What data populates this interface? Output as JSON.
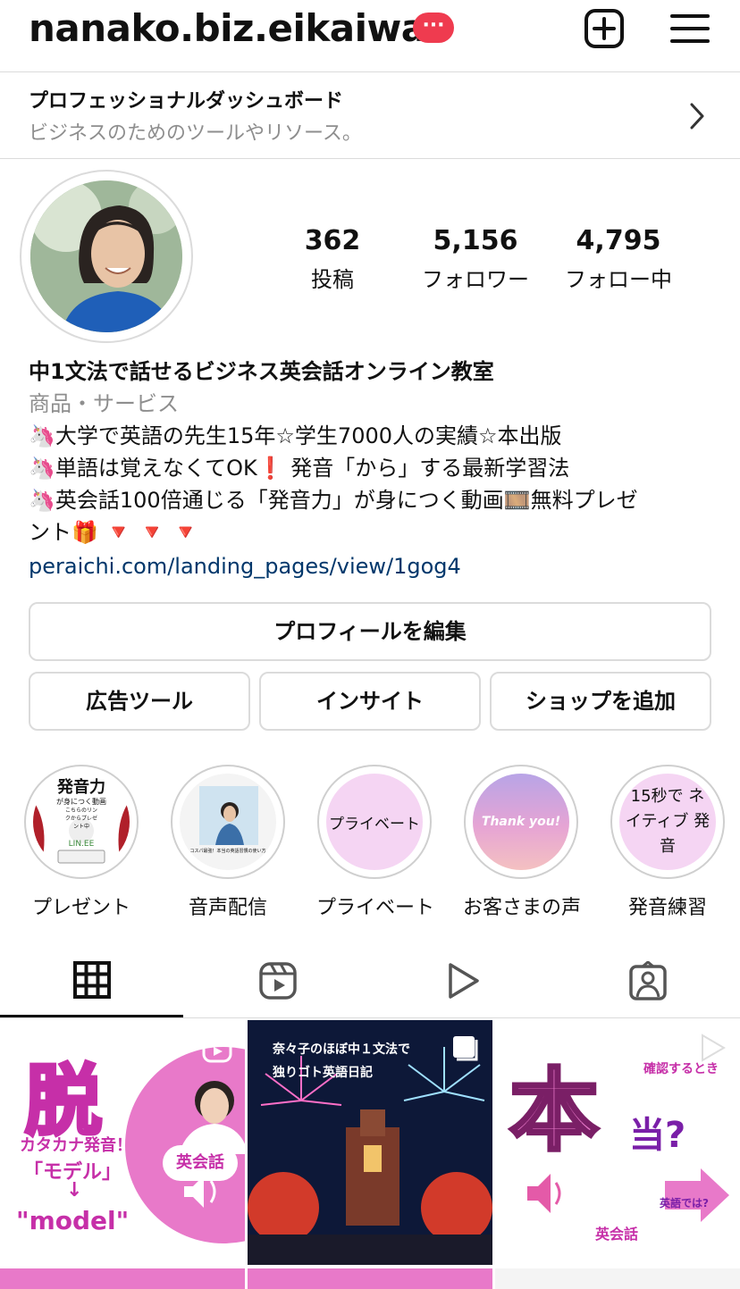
{
  "header": {
    "username": "nanako.biz.eikaiwa",
    "badge": "···"
  },
  "dashboard": {
    "title": "プロフェッショナルダッシュボード",
    "subtitle": "ビジネスのためのツールやリソース。"
  },
  "stats": [
    {
      "value": "362",
      "label": "投稿"
    },
    {
      "value": "5,156",
      "label": "フォロワー"
    },
    {
      "value": "4,795",
      "label": "フォロー中"
    }
  ],
  "bio": {
    "name": "中1文法で話せるビジネス英会話オンライン教室",
    "category": "商品・サービス",
    "lines": [
      "🦄大学で英語の先生15年☆学生7000人の実績☆本出版",
      "🦄単語は覚えなくてOK❗️ 発音「から」する最新学習法",
      "🦄英会話100倍通じる「発音力」が身につく動画🎞️無料プレゼ",
      "ント🎁 🔻 🔻 🔻"
    ],
    "link": "peraichi.com/landing_pages/view/1gog4"
  },
  "buttons": {
    "edit_profile": "プロフィールを編集",
    "ad_tools": "広告ツール",
    "insights": "インサイト",
    "add_shop": "ショップを追加"
  },
  "highlights": [
    {
      "label": "プレゼント",
      "cover_title": "発音力",
      "cover_sub": "が身につく動画",
      "cover_small": "こちらのリンクからプレゼント中",
      "cover_tag": "LIN.EE"
    },
    {
      "label": "音声配信",
      "cover_caption": "コスパ最強！本当の英語習慣の使い方"
    },
    {
      "label": "プライベート",
      "cover_text": "プライベート"
    },
    {
      "label": "お客さまの声",
      "cover_text": "Thank you!"
    },
    {
      "label": "発音練習",
      "cover_text": "15秒で ネイティブ 発音"
    }
  ],
  "tabs": [
    "grid",
    "reels",
    "videos",
    "tagged"
  ],
  "posts": [
    {
      "big": "脱",
      "line1": "カタカナ発音！",
      "line2": "「モデル」",
      "arrow": "↓",
      "line3": "\"model\"",
      "tag": "英会話"
    },
    {
      "line1": "奈々子のほぼ中１文法で",
      "line2": "独りゴト英語日記"
    },
    {
      "big": "本",
      "small": "当?",
      "top": "確認するとき",
      "arrow_text": "英語では?",
      "tag": "英会話"
    }
  ],
  "colors": {
    "badge": "#ef3b4f",
    "link": "#00376b",
    "pink": "#e879c9",
    "magenta": "#c62fa8"
  }
}
